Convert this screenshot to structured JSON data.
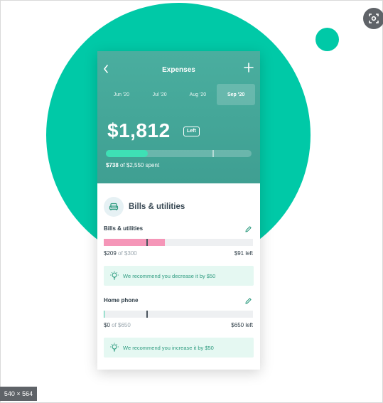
{
  "header": {
    "title": "Expenses",
    "months": [
      {
        "label": "Jun '20",
        "active": false
      },
      {
        "label": "Jul '20",
        "active": false
      },
      {
        "label": "Aug '20",
        "active": false
      },
      {
        "label": "Sep '20",
        "active": true
      }
    ],
    "amount": "$1,812",
    "left_badge": "Left",
    "spent_amount": "$738",
    "spent_rest": " of $2,550 spent",
    "progress_fraction": 0.29
  },
  "category": {
    "title": "Bills & utilities",
    "icon": "armchair-icon"
  },
  "items": [
    {
      "label": "Bills & utilities",
      "spent": "$209",
      "of_total": " of $300",
      "left": "$91 left",
      "fill_fraction": 0.41,
      "fill_color": "#f596b8",
      "recommendation": "We recommend you decrease it by $50"
    },
    {
      "label": "Home phone",
      "spent": "$0",
      "of_total": " of $650",
      "left": "$650 left",
      "fill_fraction": 0.005,
      "fill_color": "#3ecaa6",
      "recommendation": "We recommend you increase it by $50"
    }
  ],
  "overlay": {
    "size_label": "540 × 564"
  },
  "colors": {
    "brand_teal": "#00c9a7",
    "header_teal": "#4aae9f",
    "recommend_bg": "#e5f8f2"
  }
}
